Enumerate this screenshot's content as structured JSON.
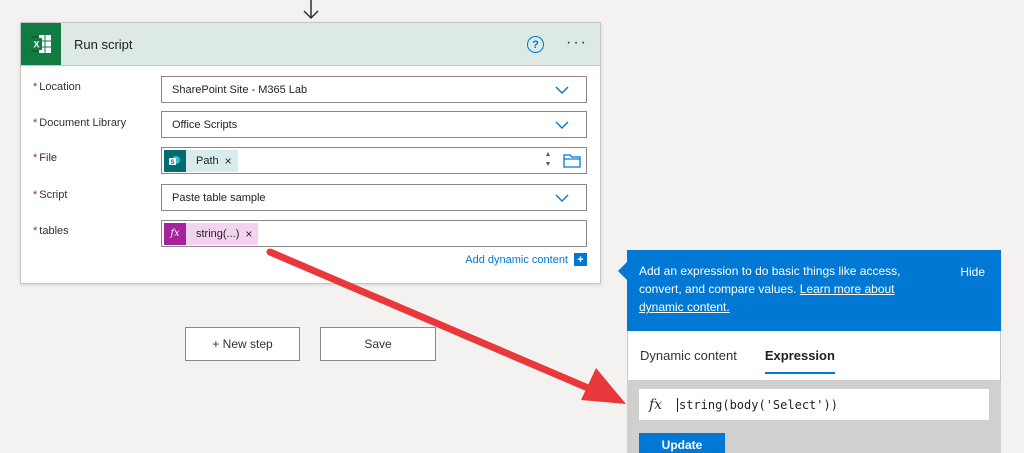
{
  "card": {
    "title": "Run script",
    "help": "?",
    "more": "···"
  },
  "fields": {
    "required_mark": "*",
    "location": {
      "label": "Location",
      "value": "SharePoint Site - M365 Lab"
    },
    "document_library": {
      "label": "Document Library",
      "value": "Office Scripts"
    },
    "file": {
      "label": "File",
      "token": "Path",
      "token_icon": "sharepoint-icon"
    },
    "script": {
      "label": "Script",
      "value": "Paste table sample"
    },
    "tables": {
      "label": "tables",
      "token": "string(...)",
      "token_icon": "fx-icon"
    },
    "remove_glyph": "×"
  },
  "add_dynamic_content": "Add dynamic content",
  "buttons": {
    "new_step": "+ New step",
    "save": "Save"
  },
  "panel": {
    "description_prefix": "Add an expression to do basic things like access, convert, and compare values.",
    "learn_more": "Learn more about dynamic content.",
    "hide": "Hide",
    "tabs": [
      "Dynamic content",
      "Expression"
    ],
    "active_tab": "Expression",
    "fx": "fx",
    "expression": "string(body('Select'))",
    "update": "Update"
  },
  "colors": {
    "accent": "#0078d4",
    "excel_green": "#107c41",
    "header_bg": "#dde9e3",
    "fx_token": "#a4239d",
    "fx_token_bg": "#f3d3ef",
    "sp_token": "#036c70",
    "sp_token_bg": "#d9ecec",
    "annotation_arrow": "#e8383b"
  }
}
